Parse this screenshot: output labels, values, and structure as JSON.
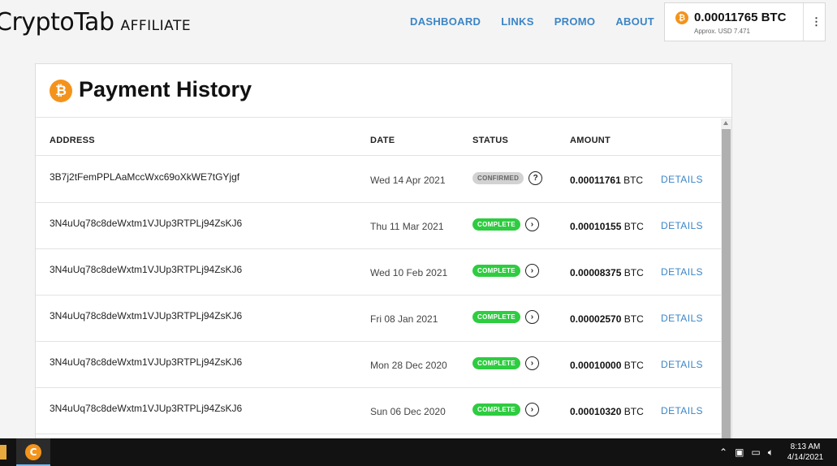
{
  "header": {
    "logo_main": "CryptoTab",
    "logo_sub": "AFFILIATE",
    "nav": [
      "DASHBOARD",
      "LINKS",
      "PROMO",
      "ABOUT"
    ],
    "balance": {
      "value": "0.00011765 BTC",
      "usd": "Approx. USD 7.471",
      "more": "⋮"
    }
  },
  "page": {
    "title": "Payment History"
  },
  "table": {
    "headers": {
      "address": "ADDRESS",
      "date": "DATE",
      "status": "STATUS",
      "amount": "AMOUNT"
    },
    "details_label": "DETAILS",
    "unit": "BTC",
    "rows": [
      {
        "address": "3B7j2tFemPPLAaMccWxc69oXkWE7tGYjgf",
        "date": "Wed 14 Apr 2021",
        "status": "CONFIRMED",
        "status_kind": "confirmed",
        "amount": "0.00011761"
      },
      {
        "address": "3N4uUq78c8deWxtm1VJUp3RTPLj94ZsKJ6",
        "date": "Thu 11 Mar 2021",
        "status": "COMPLETE",
        "status_kind": "complete",
        "amount": "0.00010155"
      },
      {
        "address": "3N4uUq78c8deWxtm1VJUp3RTPLj94ZsKJ6",
        "date": "Wed 10 Feb 2021",
        "status": "COMPLETE",
        "status_kind": "complete",
        "amount": "0.00008375"
      },
      {
        "address": "3N4uUq78c8deWxtm1VJUp3RTPLj94ZsKJ6",
        "date": "Fri 08 Jan 2021",
        "status": "COMPLETE",
        "status_kind": "complete",
        "amount": "0.00002570"
      },
      {
        "address": "3N4uUq78c8deWxtm1VJUp3RTPLj94ZsKJ6",
        "date": "Mon 28 Dec 2020",
        "status": "COMPLETE",
        "status_kind": "complete",
        "amount": "0.00010000"
      },
      {
        "address": "3N4uUq78c8deWxtm1VJUp3RTPLj94ZsKJ6",
        "date": "Sun 06 Dec 2020",
        "status": "COMPLETE",
        "status_kind": "complete",
        "amount": "0.00010320"
      }
    ]
  },
  "colors": {
    "accent": "#3a85c7",
    "bitcoin": "#f4931b",
    "complete": "#2ecc40",
    "confirmed": "#d2d2d2"
  },
  "taskbar": {
    "time": "8:13 AM",
    "date": "4/14/2021"
  }
}
